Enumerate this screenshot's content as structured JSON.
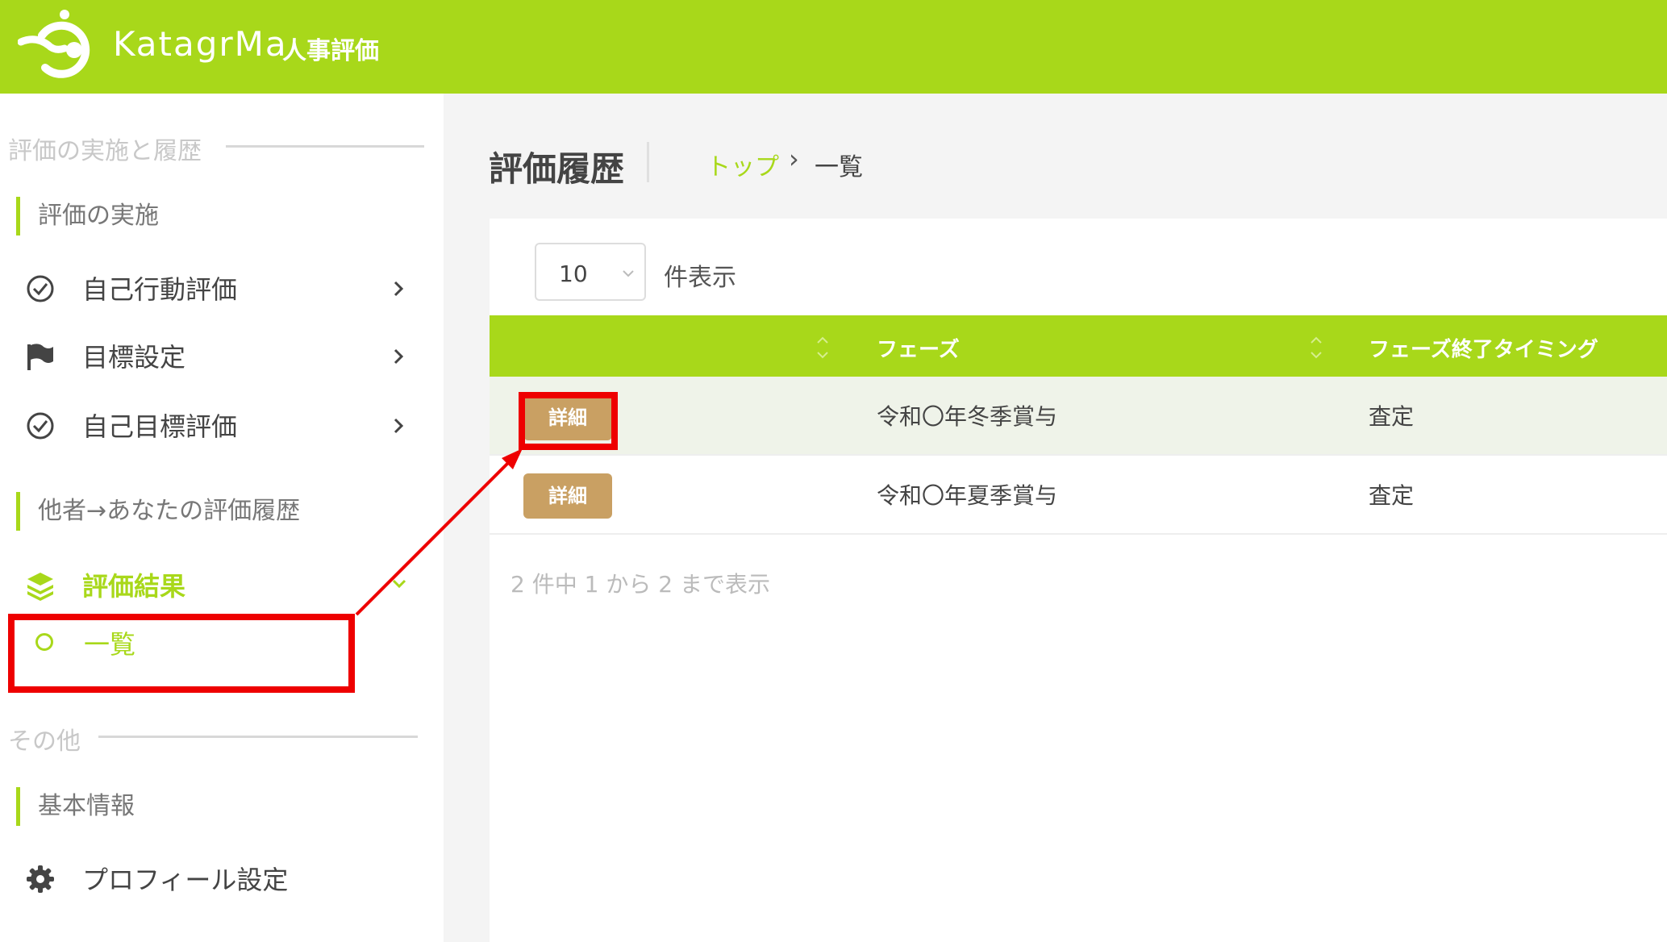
{
  "header": {
    "logo_text": "KatagrMa",
    "logo_sub": "人事評価",
    "bg_color": "#a8d81a",
    "logo_icon": "katagrma-logo-icon"
  },
  "sidebar": {
    "section1_title": "評価の実施と履歴",
    "group1_label": "評価の実施",
    "items": [
      {
        "label": "自己行動評価",
        "icon": "check-circle-icon"
      },
      {
        "label": "目標設定",
        "icon": "flag-icon"
      },
      {
        "label": "自己目標評価",
        "icon": "check-circle-icon"
      }
    ],
    "group2_label": "他者→あなたの評価履歴",
    "active_item": {
      "label": "評価結果",
      "icon": "layers-icon"
    },
    "sub_item": {
      "label": "一覧"
    },
    "section2_title": "その他",
    "group3_label": "基本情報",
    "profile_item": {
      "label": "プロフィール設定",
      "icon": "gear-icon"
    }
  },
  "main": {
    "title": "評価履歴",
    "breadcrumb": {
      "top": "トップ",
      "separator": "›",
      "current": "一覧"
    },
    "length_select": {
      "value": "10",
      "label": "件表示"
    },
    "table": {
      "headers": [
        "",
        "フェーズ",
        "フェーズ終了タイミング"
      ],
      "rows": [
        {
          "button": "詳細",
          "phase": "令和〇年冬季賞与",
          "timing": "査定"
        },
        {
          "button": "詳細",
          "phase": "令和〇年夏季賞与",
          "timing": "査定"
        }
      ]
    },
    "info": "2 件中 1 から 2 まで表示"
  },
  "colors": {
    "accent": "#a8d81a",
    "detail_button": "#c9a063",
    "highlight_row": "#eff3e9",
    "annotation_red": "#ee0000"
  }
}
